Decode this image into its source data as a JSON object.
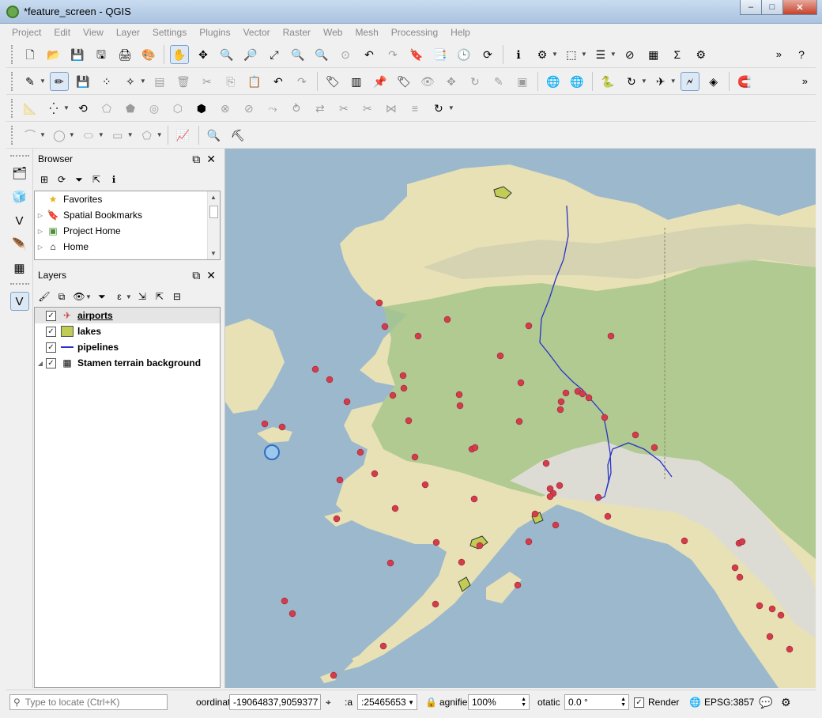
{
  "window": {
    "title": "*feature_screen - QGIS",
    "min": "–",
    "max": "□",
    "close": "✕"
  },
  "menu": [
    "Project",
    "Edit",
    "View",
    "Layer",
    "Settings",
    "Plugins",
    "Vector",
    "Raster",
    "Web",
    "Mesh",
    "Processing",
    "Help"
  ],
  "browser": {
    "title": "Browser",
    "items": [
      {
        "label": "Favorites"
      },
      {
        "label": "Spatial Bookmarks"
      },
      {
        "label": "Project Home"
      },
      {
        "label": "Home"
      }
    ]
  },
  "layers": {
    "title": "Layers",
    "items": [
      {
        "label": "airports",
        "checked": true
      },
      {
        "label": "lakes",
        "checked": true
      },
      {
        "label": "pipelines",
        "checked": true
      },
      {
        "label": "Stamen terrain background",
        "checked": true
      }
    ]
  },
  "status": {
    "locate_placeholder": "Type to locate (Ctrl+K)",
    "coordinate_label": "oordinat",
    "coordinate_value": "-19064837,9059377",
    "scale_label": ":a",
    "scale_value": ":25465653",
    "magnifier_label": "agnifie",
    "magnifier_value": "100%",
    "rotation_label": "otatic",
    "rotation_value": "0.0 °",
    "render_label": "Render",
    "render_checked": true,
    "crs": "EPSG:3857"
  },
  "colors": {
    "ocean": "#9cb8cd",
    "land": "#e8e1b5",
    "forest": "#a6c58c",
    "mountain": "#dcdcd4",
    "airport": "#d33c4c",
    "pipeline": "#2a33c8",
    "lake": "#c0cc54"
  }
}
